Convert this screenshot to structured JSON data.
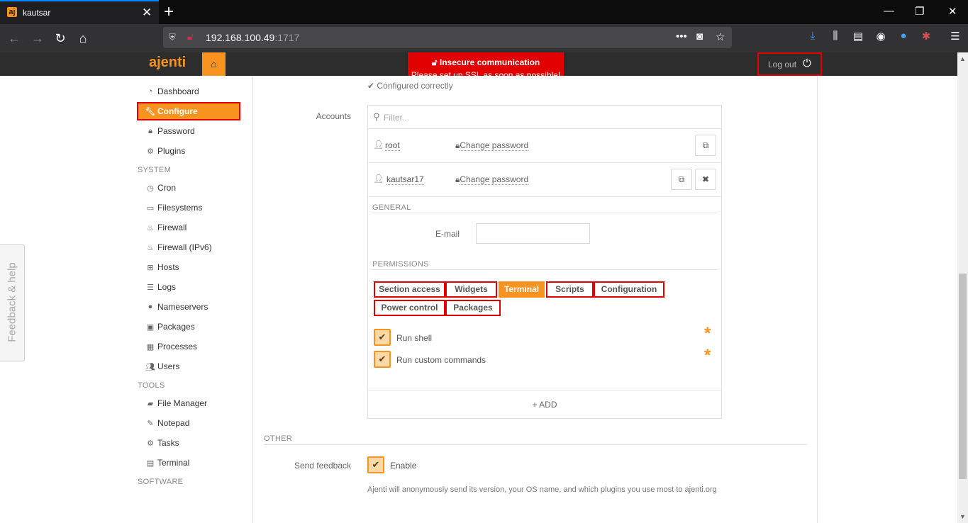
{
  "browser": {
    "tab_title": "kautsar",
    "favicon": "aj",
    "url_host": "192.168.100.49",
    "url_port": ":1717"
  },
  "header": {
    "logo": "ajenti",
    "logout_label": "Log out"
  },
  "ssl_warning": {
    "title": "Insecure communication",
    "message": "Please set up SSL as soon as possible!"
  },
  "sidebar": {
    "items": [
      {
        "label": "Dashboard"
      },
      {
        "label": "Configure"
      },
      {
        "label": "Password"
      },
      {
        "label": "Plugins"
      }
    ],
    "system_heading": "SYSTEM",
    "system_items": [
      {
        "label": "Cron"
      },
      {
        "label": "Filesystems"
      },
      {
        "label": "Firewall"
      },
      {
        "label": "Firewall (IPv6)"
      },
      {
        "label": "Hosts"
      },
      {
        "label": "Logs"
      },
      {
        "label": "Nameservers"
      },
      {
        "label": "Packages"
      },
      {
        "label": "Processes"
      },
      {
        "label": "Users"
      }
    ],
    "tools_heading": "TOOLS",
    "tools_items": [
      {
        "label": "File Manager"
      },
      {
        "label": "Notepad"
      },
      {
        "label": "Tasks"
      },
      {
        "label": "Terminal"
      }
    ],
    "software_heading": "SOFTWARE"
  },
  "feedback_tab": "Feedback & help",
  "main": {
    "configured_text": "Configured correctly",
    "accounts_label": "Accounts",
    "filter_placeholder": "Filter...",
    "accounts": [
      {
        "username": "root",
        "change_password": "Change password"
      },
      {
        "username": "kautsar17",
        "change_password": "Change password"
      }
    ],
    "general_heading": "GENERAL",
    "email_label": "E-mail",
    "email_value": "",
    "permissions_heading": "PERMISSIONS",
    "permission_tabs": [
      "Section access",
      "Widgets",
      "Terminal",
      "Scripts",
      "Configuration",
      "Power control",
      "Packages"
    ],
    "active_tab": "Terminal",
    "permissions": [
      {
        "label": "Run shell",
        "checked": true
      },
      {
        "label": "Run custom commands",
        "checked": true
      }
    ],
    "add_label": "ADD",
    "other_heading": "OTHER",
    "send_feedback_label": "Send feedback",
    "enable_label": "Enable",
    "feedback_note": "Ajenti will anonymously send its version, your OS name, and which plugins you use most to ajenti.org"
  },
  "colors": {
    "accent": "#f7931e",
    "highlight": "#e00000",
    "header_bg": "#2d2d2d"
  }
}
